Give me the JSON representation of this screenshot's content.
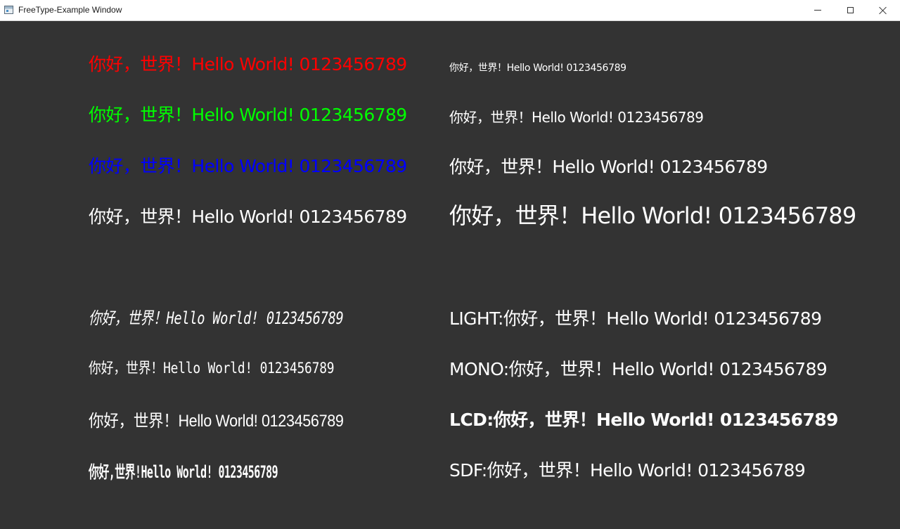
{
  "window": {
    "title": "FreeType-Example Window"
  },
  "colors": {
    "background": "#333333",
    "red": "#ff0000",
    "green": "#00ff00",
    "blue": "#0000ff",
    "white": "#ffffff"
  },
  "left_samples": [
    {
      "text": "你好，世界！Hello World! 0123456789",
      "color": "#ff0000"
    },
    {
      "text": "你好，世界！Hello World! 0123456789",
      "color": "#00ff00"
    },
    {
      "text": "你好，世界！Hello World! 0123456789",
      "color": "#0000ff"
    },
    {
      "text": "你好，世界！Hello World! 0123456789",
      "color": "#ffffff"
    },
    {
      "text": "你好，世界！Hello World! 0123456789",
      "color": "#ffffff"
    },
    {
      "text": "你好，世界！Hello World! 0123456789",
      "color": "#ffffff"
    },
    {
      "text": "你好，世界！Hello World! 0123456789",
      "color": "#ffffff"
    },
    {
      "text": "你好,世界!Hello World! 0123456789",
      "color": "#ffffff"
    }
  ],
  "right_samples": [
    {
      "text": "你好，世界！Hello World! 0123456789"
    },
    {
      "text": "你好，世界！Hello World! 0123456789"
    },
    {
      "text": "你好，世界！Hello World! 0123456789"
    },
    {
      "text": "你好，世界！Hello World! 0123456789"
    },
    {
      "text": "LIGHT:你好，世界！Hello World! 0123456789"
    },
    {
      "text": "MONO:你好，世界！Hello World! 0123456789"
    },
    {
      "text": "LCD:你好，世界！Hello World! 0123456789"
    },
    {
      "text": "SDF:你好，世界！Hello World! 0123456789"
    }
  ]
}
